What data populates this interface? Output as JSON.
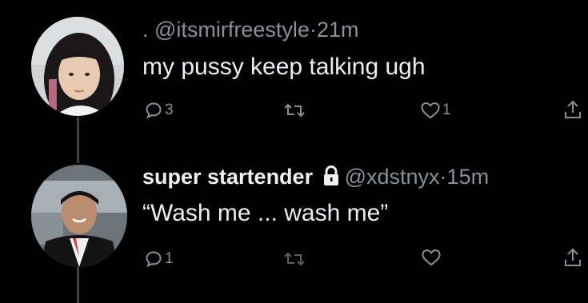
{
  "tweets": [
    {
      "display_name": "",
      "handle": ". @itsmirfreestyle",
      "separator": "·",
      "time": "21m",
      "text": "my pussy keep talking ugh",
      "actions": {
        "reply_count": "3",
        "retweet_count": "",
        "like_count": "1"
      }
    },
    {
      "display_name": "super startender",
      "protected": true,
      "handle": "@xdstnyx",
      "separator": "·",
      "time": "15m",
      "text": "“Wash me ... wash me”",
      "actions": {
        "reply_count": "1",
        "retweet_count": "",
        "like_count": ""
      }
    }
  ],
  "icons": {
    "reply": "speech-bubble-icon",
    "retweet": "retweet-icon",
    "like": "heart-icon",
    "share": "share-upload-icon",
    "lock": "lock-icon"
  },
  "colors": {
    "background": "#000000",
    "text": "#e7e9ea",
    "muted": "#8b9096",
    "thread_line": "#3e4144"
  }
}
